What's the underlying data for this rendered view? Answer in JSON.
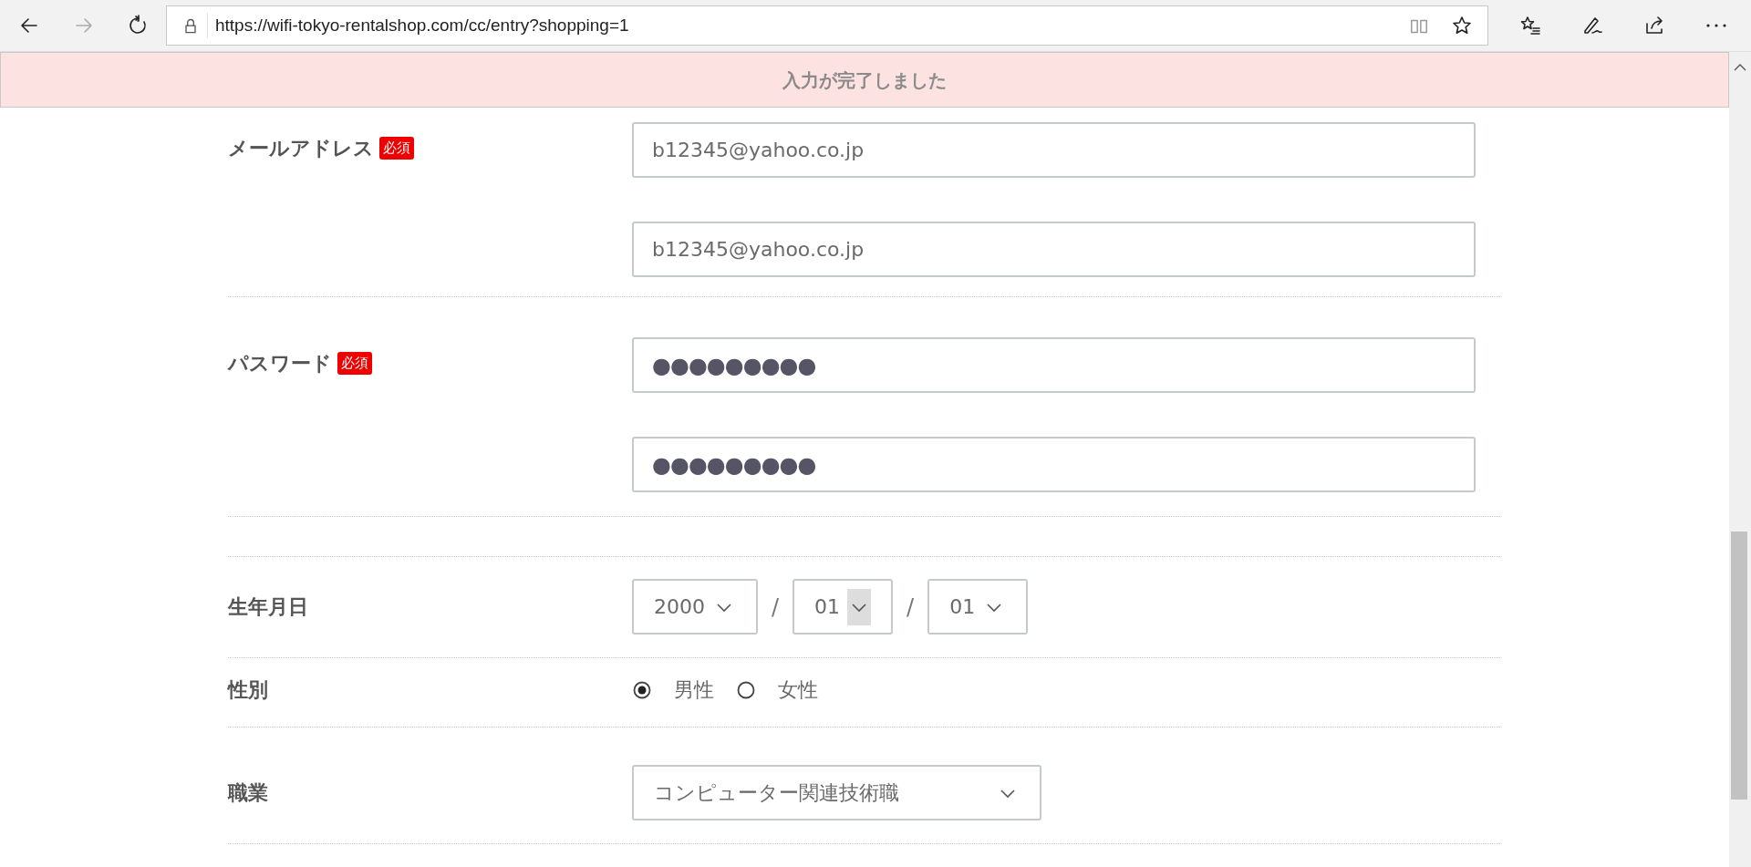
{
  "browser": {
    "url": "https://wifi-tokyo-rentalshop.com/cc/entry?shopping=1",
    "back_disabled": false,
    "forward_disabled": true
  },
  "banner": {
    "text": "入力が完了しました"
  },
  "rows": [
    {
      "kind": "email",
      "label": "メールアドレス",
      "required_badge": "必須",
      "values": [
        "b12345@yahoo.co.jp",
        "b12345@yahoo.co.jp"
      ]
    },
    {
      "kind": "password",
      "label": "パスワード",
      "required_badge": "必須",
      "values": [
        "●●●●●●●●●",
        "●●●●●●●●●"
      ]
    },
    {
      "kind": "spacer"
    },
    {
      "kind": "date",
      "label": "生年月日",
      "parts": [
        {
          "value": "2000",
          "hovered": false
        },
        {
          "value": "01",
          "hovered": true
        },
        {
          "value": "01",
          "hovered": false
        }
      ],
      "separators": [
        "/",
        "/"
      ]
    },
    {
      "kind": "radio",
      "label": "性別",
      "options": [
        {
          "label": "男性",
          "selected": true
        },
        {
          "label": "女性",
          "selected": false
        }
      ]
    },
    {
      "kind": "select",
      "label": "職業",
      "value": "コンピューター関連技術職"
    }
  ]
}
